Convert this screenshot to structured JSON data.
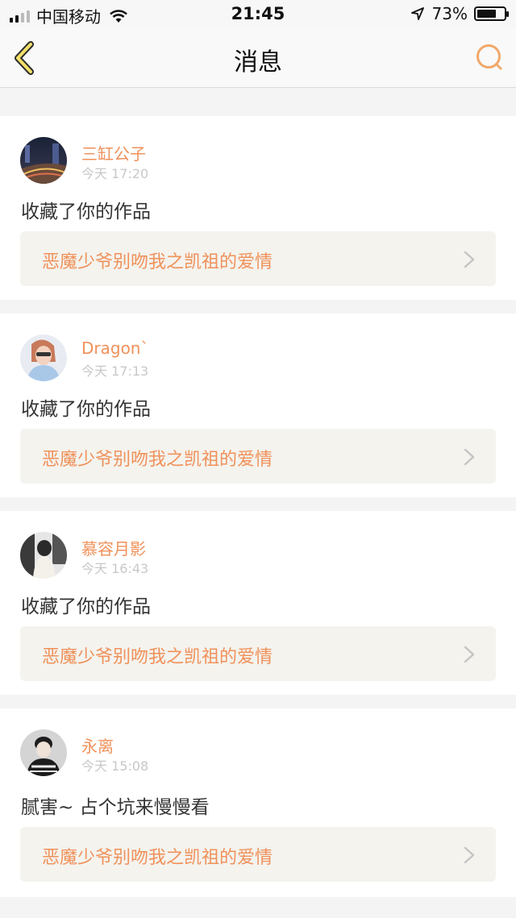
{
  "status_bar": {
    "carrier": "中国移动",
    "time": "21:45",
    "battery_percent": "73%",
    "battery_level": 0.73,
    "signal_bars": 4,
    "signal_strength": 2
  },
  "nav": {
    "title": "消息",
    "back_icon": "chevron-left-icon",
    "search_icon": "search-icon",
    "accent_color": "#f0a86a"
  },
  "messages": [
    {
      "user": "三缸公子",
      "time": "今天 17:20",
      "action": "收藏了你的作品",
      "work_title": "恶魔少爷别吻我之凯祖的爱情"
    },
    {
      "user": "Dragon`",
      "time": "今天 17:13",
      "action": "收藏了你的作品",
      "work_title": "恶魔少爷别吻我之凯祖的爱情"
    },
    {
      "user": "慕容月影",
      "time": "今天 16:43",
      "action": "收藏了你的作品",
      "work_title": "恶魔少爷别吻我之凯祖的爱情"
    },
    {
      "user": "永离",
      "time": "今天 15:08",
      "action": "腻害~ 占个坑来慢慢看",
      "work_title": "恶魔少爷别吻我之凯祖的爱情"
    }
  ],
  "colors": {
    "username": "#f0915a",
    "work_bg": "#f4f3ee",
    "timestamp": "#c8c8c8"
  }
}
